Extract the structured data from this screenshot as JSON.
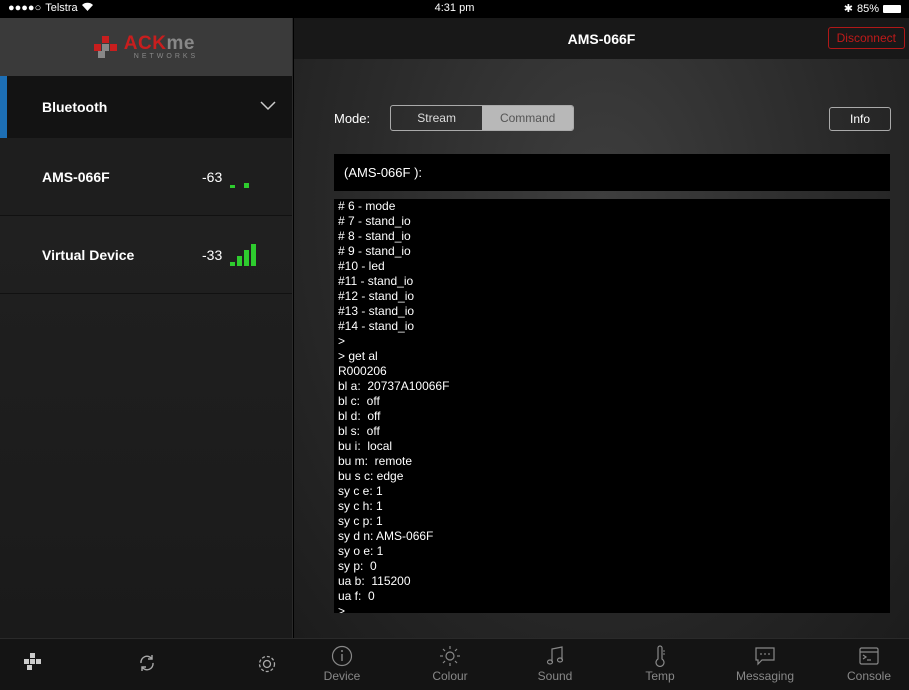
{
  "status": {
    "carrier": "Telstra",
    "time": "4:31 pm",
    "battery": "85%"
  },
  "sidebar": {
    "logo_ack": "ACK",
    "logo_me": "me",
    "logo_sub": "NETWORKS",
    "section": "Bluetooth",
    "devices": [
      {
        "name": "AMS-066F",
        "rssi": "-63",
        "bars": 1
      },
      {
        "name": "Virtual Device",
        "rssi": "-33",
        "bars": 4
      }
    ]
  },
  "header": {
    "title": "AMS-066F",
    "disconnect": "Disconnect"
  },
  "mode": {
    "label": "Mode:",
    "stream": "Stream",
    "command": "Command",
    "selected": "Command",
    "info": "Info"
  },
  "command_prompt": "(AMS-066F ):",
  "console_lines": [
    "# 6 - mode",
    "# 7 - stand_io",
    "# 8 - stand_io",
    "# 9 - stand_io",
    "#10 - led",
    "#11 - stand_io",
    "#12 - stand_io",
    "#13 - stand_io",
    "#14 - stand_io",
    ">",
    "> get al",
    "R000206",
    "bl a:  20737A10066F",
    "bl c:  off",
    "bl d:  off",
    "bl s:  off",
    "bu i:  local",
    "bu m:  remote",
    "bu s c: edge",
    "sy c e: 1",
    "sy c h: 1",
    "sy c p: 1",
    "sy d n: AMS-066F",
    "sy o e: 1",
    "sy p:  0",
    "ua b:  115200",
    "ua f:  0",
    ">"
  ],
  "tabs": [
    {
      "label": "Device",
      "icon": "info-icon"
    },
    {
      "label": "Colour",
      "icon": "sun-icon"
    },
    {
      "label": "Sound",
      "icon": "music-note-icon"
    },
    {
      "label": "Temp",
      "icon": "thermometer-icon"
    },
    {
      "label": "Messaging",
      "icon": "chat-icon"
    },
    {
      "label": "Console",
      "icon": "console-icon"
    }
  ],
  "colors": {
    "accent_blue": "#1d6fb5",
    "signal_green": "#2ecc2e",
    "disconnect_red": "#c01a1a"
  }
}
